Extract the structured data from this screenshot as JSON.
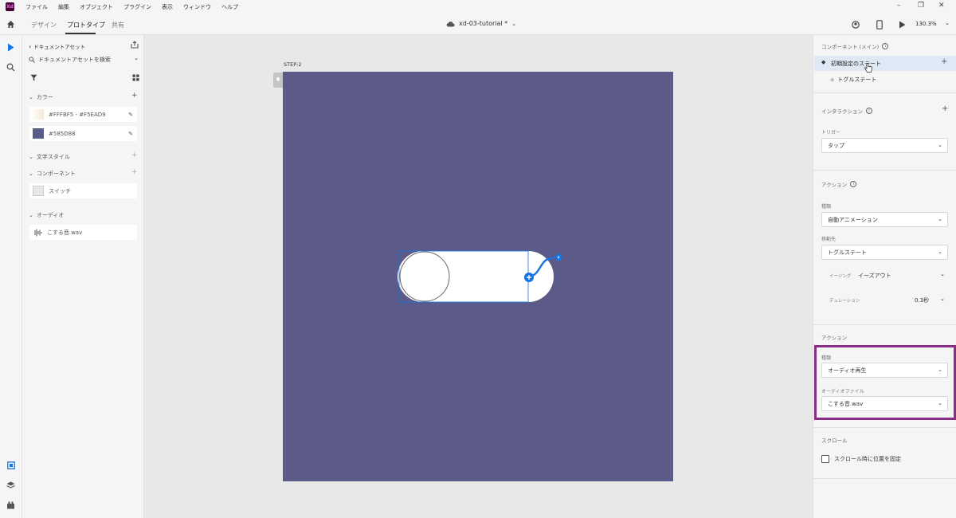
{
  "menubar": {
    "logo": "Xd",
    "items": [
      "ファイル",
      "編集",
      "オブジェクト",
      "プラグイン",
      "表示",
      "ウィンドウ",
      "ヘルプ"
    ]
  },
  "toolbar": {
    "tabs": [
      "デザイン",
      "プロトタイプ",
      "共有"
    ],
    "active_tab": "プロトタイプ",
    "doc_title": "xd-03-tutorial *",
    "zoom": "130.3%"
  },
  "assets": {
    "back_label": "ドキュメントアセット",
    "search_placeholder": "ドキュメントアセットを検索",
    "colors_label": "カラー",
    "color_items": [
      {
        "label": "#FFFBF5 - #F5EAD9",
        "swatch": "#f9efe3"
      },
      {
        "label": "#585D88",
        "swatch": "#585d88"
      }
    ],
    "text_styles_label": "文字スタイル",
    "components_label": "コンポーネント",
    "component_items": [
      "スイッチ"
    ],
    "audio_label": "オーディオ",
    "audio_items": [
      "こする音.wav"
    ]
  },
  "canvas": {
    "artboard_label": "STEP-2",
    "artboard_color": "#5b5a88",
    "accent": "#1473e6"
  },
  "props": {
    "component_head": "コンポーネント (メイン)",
    "states": [
      "初期設定のステート",
      "トグルステート"
    ],
    "interaction_head": "インタラクション",
    "trigger_label": "トリガー",
    "trigger_value": "タップ",
    "action_head": "アクション",
    "type_label": "種類",
    "type_value": "自動アニメーション",
    "destination_label": "移動先",
    "destination_value": "トグルステート",
    "easing_label": "イージング",
    "easing_value": "イーズアウト",
    "duration_label": "デュレーション",
    "duration_value": "0.3秒",
    "action2_head": "アクション",
    "type2_label": "種類",
    "type2_value": "オーディオ再生",
    "audio_file_label": "オーディオファイル",
    "audio_file_value": "こする音.wav",
    "highlight_color": "#8b2c86",
    "scroll_head": "スクロール",
    "scroll_checkbox_label": "スクロール時に位置を固定"
  }
}
